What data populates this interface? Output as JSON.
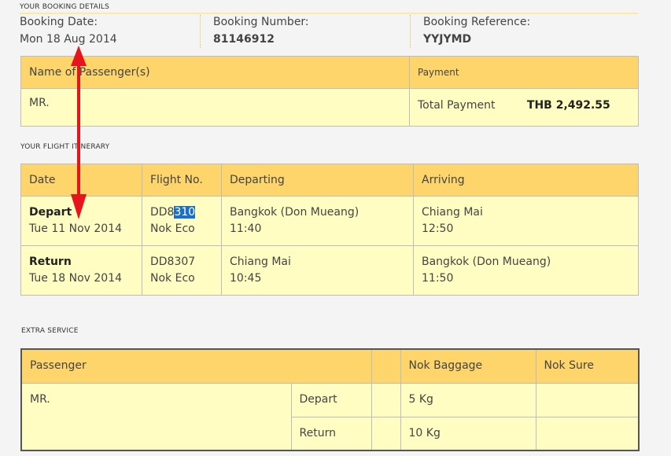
{
  "booking_details": {
    "title": "YOUR BOOKING DETAILS",
    "date_label": "Booking Date:",
    "date_value": "Mon 18 Aug 2014",
    "number_label": "Booking Number:",
    "number_value": "81146912",
    "reference_label": "Booking Reference:",
    "reference_value": "YYJYMD"
  },
  "passenger_table": {
    "name_header": "Name of Passenger(s)",
    "payment_header": "Payment",
    "passenger_name": "MR.",
    "total_label": "Total Payment",
    "total_value": "THB 2,492.55"
  },
  "itinerary": {
    "title": "YOUR FLIGHT ITINERARY",
    "headers": {
      "date": "Date",
      "flight": "Flight No.",
      "departing": "Departing",
      "arriving": "Arriving"
    },
    "rows": [
      {
        "type": "Depart",
        "date": "Tue 11 Nov 2014",
        "flight_prefix": "DD8",
        "flight_selected": "310",
        "flight_suffix": "",
        "carrier": "Nok Eco",
        "from": "Bangkok (Don Mueang)",
        "dep_time": "11:40",
        "to": "Chiang Mai",
        "arr_time": "12:50"
      },
      {
        "type": "Return",
        "date": "Tue 18 Nov 2014",
        "flight_prefix": "DD8307",
        "flight_selected": "",
        "flight_suffix": "",
        "carrier": "Nok Eco",
        "from": "Chiang Mai",
        "dep_time": "10:45",
        "to": "Bangkok (Don Mueang)",
        "arr_time": "11:50"
      }
    ]
  },
  "extra_service": {
    "title": "EXTRA SERVICE",
    "headers": {
      "passenger": "Passenger",
      "blank": "",
      "baggage": "Nok Baggage",
      "sure": "Nok Sure"
    },
    "passenger_name": "MR.",
    "rows": [
      {
        "leg": "Depart",
        "baggage": "5 Kg",
        "sure": ""
      },
      {
        "leg": "Return",
        "baggage": "10 Kg",
        "sure": ""
      }
    ]
  },
  "colors": {
    "header_bg": "#fed56b",
    "cell_bg": "#fffdc2",
    "annotation_arrow": "#e8141c",
    "selection_highlight": "#1a6fc8"
  }
}
